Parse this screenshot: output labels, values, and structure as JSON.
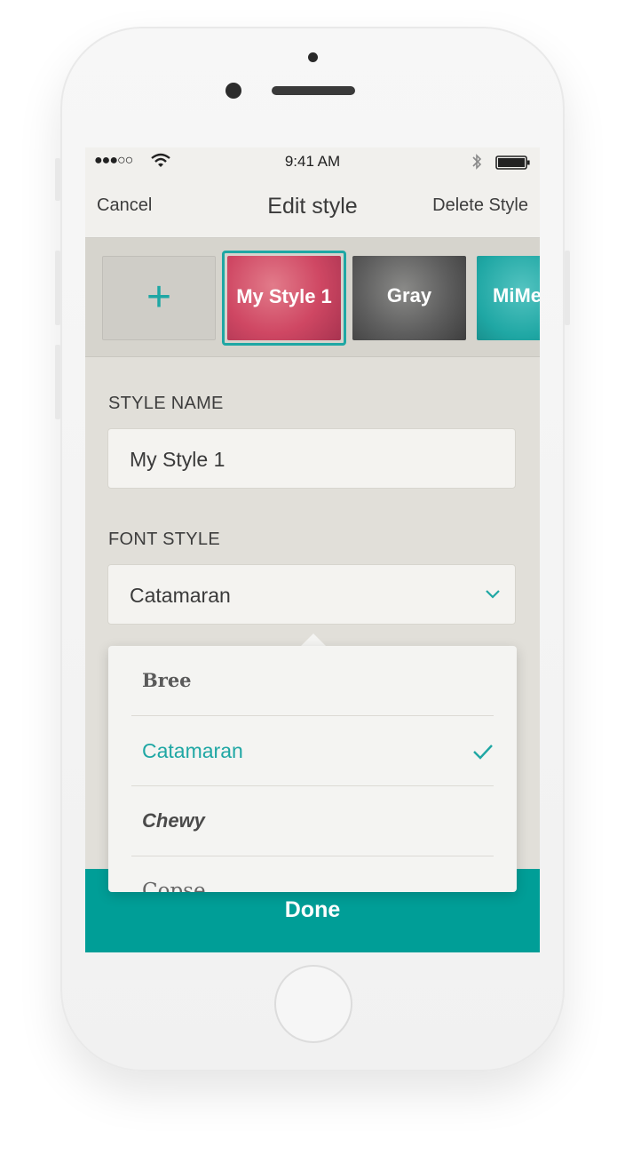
{
  "status": {
    "signal": "●●●○○",
    "time": "9:41 AM"
  },
  "nav": {
    "cancel": "Cancel",
    "title": "Edit style",
    "delete": "Delete Style"
  },
  "styles": {
    "add_symbol": "+",
    "items": [
      {
        "label": "My Style 1",
        "selected": true,
        "tint": "#cf4763"
      },
      {
        "label": "Gray",
        "selected": false,
        "tint": "#5e5e5e"
      },
      {
        "label": "MiMe",
        "selected": false,
        "tint": "#1fa7a4"
      }
    ]
  },
  "form": {
    "style_name_label": "STYLE NAME",
    "style_name_value": "My Style 1",
    "font_style_label": "FONT STYLE",
    "font_style_value": "Catamaran"
  },
  "font_options": [
    {
      "label": "Bree",
      "selected": false
    },
    {
      "label": "Catamaran",
      "selected": true
    },
    {
      "label": "Chewy",
      "selected": false
    },
    {
      "label": "Copse",
      "selected": false
    }
  ],
  "done_label": "Done",
  "colors": {
    "accent": "#009e97",
    "background": "#e1dfd9",
    "panel": "#f1f0ed"
  }
}
